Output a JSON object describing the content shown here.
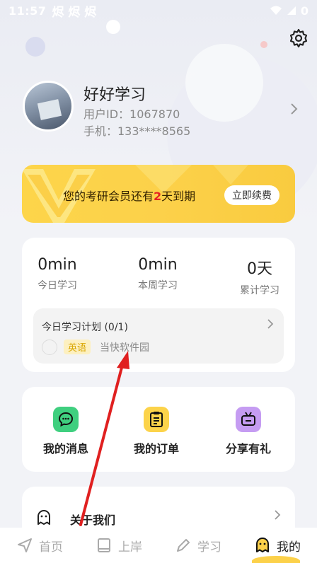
{
  "status_bar": {
    "time": "11:57",
    "extra_icons": "烬 烬 烬",
    "battery_label": "0"
  },
  "settings": {
    "icon": "gear-icon"
  },
  "profile": {
    "name": "好好学习",
    "user_id": "用户ID：1067870",
    "phone": "手机：133****8565"
  },
  "vip": {
    "text_before": "您的考研会员还有",
    "days": "2",
    "text_after": "天到期",
    "renew_label": "立即续费"
  },
  "stats": [
    {
      "value": "0min",
      "label": "今日学习"
    },
    {
      "value": "0min",
      "label": "本周学习"
    },
    {
      "value": "0天",
      "label": "累计学习"
    }
  ],
  "plan": {
    "title": "今日学习计划 (0/1)",
    "tag": "英语",
    "subtitle": "当快软件园"
  },
  "actions": [
    {
      "label": "我的消息",
      "icon": "message-icon",
      "color": "#3fcf7f"
    },
    {
      "label": "我的订单",
      "icon": "clipboard-icon",
      "color": "#fcd34a"
    },
    {
      "label": "分享有礼",
      "icon": "tv-gift-icon",
      "color": "#c59cf2"
    }
  ],
  "menu": {
    "about_label": "关于我们"
  },
  "tabs": [
    {
      "label": "首页",
      "icon": "send-icon",
      "active": false
    },
    {
      "label": "上岸",
      "icon": "book-icon",
      "active": false
    },
    {
      "label": "学习",
      "icon": "pen-icon",
      "active": false
    },
    {
      "label": "我的",
      "icon": "ghost-icon",
      "active": true
    }
  ],
  "colors": {
    "accent_yellow": "#fcd14a",
    "annotation_red": "#e02020",
    "highlight_red": "#e52222"
  }
}
